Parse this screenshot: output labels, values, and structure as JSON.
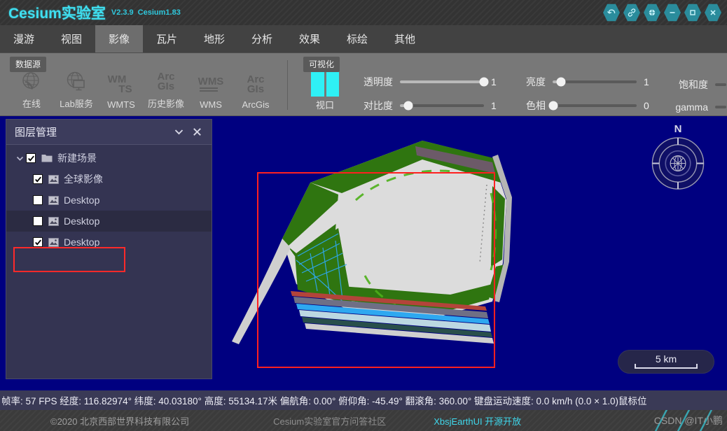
{
  "titlebar": {
    "brand": "Cesium实验室",
    "version": "V2.3.9",
    "engine": "Cesium1.83",
    "buttons": [
      {
        "name": "undo-icon",
        "label": "撤销"
      },
      {
        "name": "link-icon",
        "label": "链接"
      },
      {
        "name": "globe-target-icon",
        "label": "定位"
      },
      {
        "name": "minimize-icon",
        "label": "最小化"
      },
      {
        "name": "maximize-icon",
        "label": "最大化"
      },
      {
        "name": "close-icon",
        "label": "关闭"
      }
    ]
  },
  "tabs": [
    {
      "label": "漫游",
      "active": false
    },
    {
      "label": "视图",
      "active": false
    },
    {
      "label": "影像",
      "active": true
    },
    {
      "label": "瓦片",
      "active": false
    },
    {
      "label": "地形",
      "active": false
    },
    {
      "label": "分析",
      "active": false
    },
    {
      "label": "效果",
      "active": false
    },
    {
      "label": "标绘",
      "active": false
    },
    {
      "label": "其他",
      "active": false
    }
  ],
  "ribbon": {
    "datasource": {
      "title": "数据源",
      "tools": [
        {
          "label": "在线",
          "icon": "globe-signal-icon"
        },
        {
          "label": "Lab服务",
          "icon": "globe-monitor-icon"
        },
        {
          "label": "WMTS",
          "icon": "wmts-text-icon",
          "line1": "WM",
          "line2": "TS"
        },
        {
          "label": "历史影像",
          "icon": "arcgis-text-icon",
          "line1": "Arc",
          "line2": "GIs"
        },
        {
          "label": "WMS",
          "icon": "wms-text-icon",
          "line1": "WMS",
          "line2": ""
        },
        {
          "label": "ArcGis",
          "icon": "arcgis-text-icon",
          "line1": "Arc",
          "line2": "GIs"
        }
      ]
    },
    "visualization": {
      "title": "可视化",
      "viewport": {
        "label": "视口",
        "icon": "viewport-icon",
        "color": "#2ff0f5"
      },
      "sliders": [
        {
          "label": "透明度",
          "value": "1",
          "percent": 100,
          "filled": true
        },
        {
          "label": "对比度",
          "value": "1",
          "percent": 8,
          "filled": false
        },
        {
          "label": "亮度",
          "value": "1",
          "percent": 10,
          "filled": false
        },
        {
          "label": "色相",
          "value": "0",
          "percent": 0,
          "filled": false
        },
        {
          "label": "饱和度",
          "value": "",
          "percent": 0,
          "filled": false
        },
        {
          "label": "gamma",
          "value": "",
          "percent": 0,
          "filled": false
        }
      ]
    }
  },
  "layerpanel": {
    "title": "图层管理",
    "collapse_icon": "chevron-down-icon",
    "close_icon": "close-icon",
    "tree": [
      {
        "label": "新建场景",
        "checked": true,
        "icon": "folder-icon",
        "level": 0,
        "expandable": true,
        "selected": false,
        "highlighted": false
      },
      {
        "label": "全球影像",
        "checked": true,
        "icon": "image-layer-icon",
        "level": 1,
        "expandable": false,
        "selected": false,
        "highlighted": false
      },
      {
        "label": "Desktop",
        "checked": false,
        "icon": "image-layer-icon",
        "level": 1,
        "expandable": false,
        "selected": false,
        "highlighted": false
      },
      {
        "label": "Desktop",
        "checked": false,
        "icon": "image-layer-icon",
        "level": 1,
        "expandable": false,
        "selected": true,
        "highlighted": false
      },
      {
        "label": "Desktop",
        "checked": true,
        "icon": "image-layer-icon",
        "level": 1,
        "expandable": false,
        "selected": false,
        "highlighted": true
      }
    ]
  },
  "map": {
    "background_color": "#000080",
    "compass": {
      "north_label": "N",
      "icon": "compass-icon"
    },
    "scale": {
      "label": "5 km"
    },
    "selection_rect_color": "#ff2020"
  },
  "statusbar": {
    "text": "帧率: 57 FPS 经度: 116.82974° 纬度: 40.03180° 高度: 55134.17米 偏航角: 0.00° 俯仰角: -45.49° 翻滚角: 360.00° 键盘运动速度: 0.0 km/h (0.0 × 1.0)鼠标位",
    "fps": "57 FPS",
    "longitude": "116.82974°",
    "latitude": "40.03180°",
    "height": "55134.17米",
    "heading": "0.00°",
    "pitch": "-45.49°",
    "roll": "360.00°",
    "keyboard_speed": "0.0 km/h (0.0 × 1.0)"
  },
  "footer": {
    "copyright": "©2020 北京西部世界科技有限公司",
    "qa": "Cesium实验室官方问答社区",
    "opensource": "XbsjEarthUI 开源开放",
    "watermark": "CSDN @IT小鹏"
  }
}
